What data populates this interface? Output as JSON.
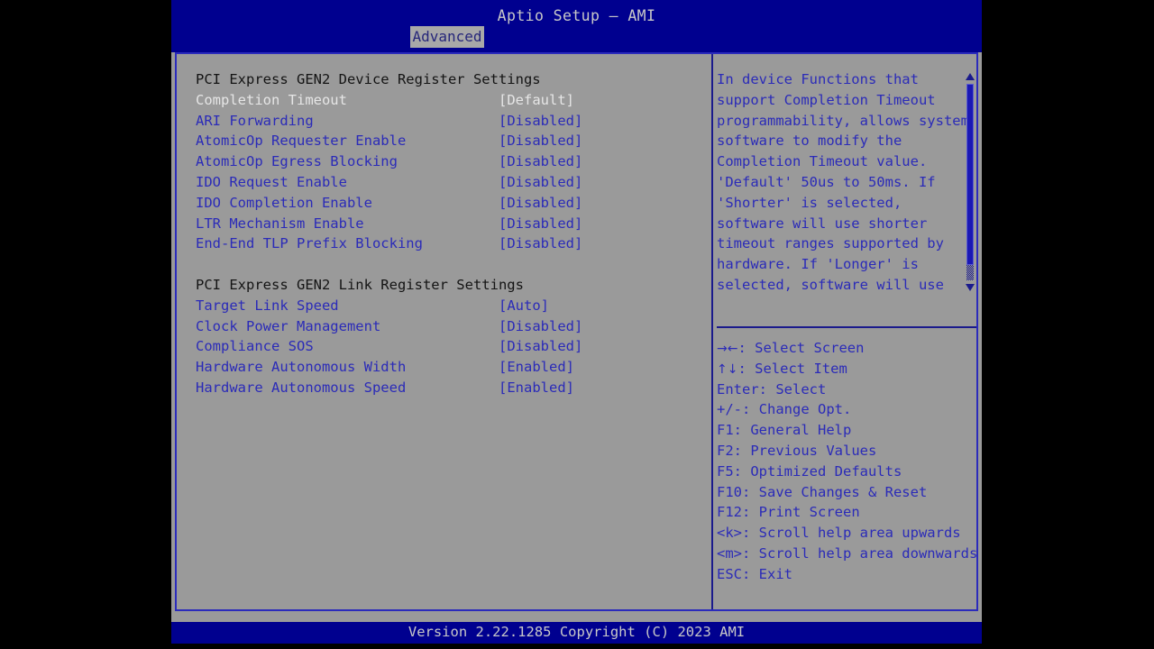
{
  "app": {
    "title": "Aptio Setup – AMI",
    "footer": "Version 2.22.1285 Copyright (C) 2023 AMI"
  },
  "tabs": [
    {
      "label": "Advanced",
      "active": true
    }
  ],
  "settings": {
    "groups": [
      {
        "header": "PCI Express GEN2 Device Register Settings",
        "items": [
          {
            "label": "Completion Timeout",
            "value": "[Default]",
            "selected": true
          },
          {
            "label": "ARI Forwarding",
            "value": "[Disabled]",
            "selected": false
          },
          {
            "label": "AtomicOp Requester Enable",
            "value": "[Disabled]",
            "selected": false
          },
          {
            "label": "AtomicOp Egress Blocking",
            "value": "[Disabled]",
            "selected": false
          },
          {
            "label": "IDO Request Enable",
            "value": "[Disabled]",
            "selected": false
          },
          {
            "label": "IDO Completion Enable",
            "value": "[Disabled]",
            "selected": false
          },
          {
            "label": "LTR Mechanism Enable",
            "value": "[Disabled]",
            "selected": false
          },
          {
            "label": "End-End TLP Prefix Blocking",
            "value": "[Disabled]",
            "selected": false
          }
        ]
      },
      {
        "header": "PCI Express GEN2 Link Register Settings",
        "items": [
          {
            "label": "Target Link Speed",
            "value": "[Auto]",
            "selected": false
          },
          {
            "label": "Clock Power Management",
            "value": "[Disabled]",
            "selected": false
          },
          {
            "label": "Compliance SOS",
            "value": "[Disabled]",
            "selected": false
          },
          {
            "label": "Hardware Autonomous Width",
            "value": "[Enabled]",
            "selected": false
          },
          {
            "label": "Hardware Autonomous Speed",
            "value": "[Enabled]",
            "selected": false
          }
        ]
      }
    ]
  },
  "help": {
    "lines": [
      "In device Functions that",
      "support Completion Timeout",
      "programmability, allows system",
      "software to modify the",
      "Completion Timeout value.",
      "'Default' 50us to 50ms. If",
      "'Shorter' is selected,",
      "software will use shorter",
      "timeout ranges supported by",
      "hardware. If 'Longer' is",
      "selected, software will use"
    ],
    "scrollbar": {
      "up_icon": "triangle-up-icon",
      "down_icon": "triangle-down-icon"
    }
  },
  "keys": [
    {
      "key": "→←",
      "label": ": Select Screen"
    },
    {
      "key": "↑↓",
      "label": ": Select Item"
    },
    {
      "key": "Enter",
      "label": ": Select"
    },
    {
      "key": "+/-",
      "label": ": Change Opt."
    },
    {
      "key": "F1",
      "label": ": General Help"
    },
    {
      "key": "F2",
      "label": ": Previous Values"
    },
    {
      "key": "F5",
      "label": ": Optimized Defaults"
    },
    {
      "key": "F10",
      "label": ": Save Changes & Reset"
    },
    {
      "key": "F12",
      "label": ": Print Screen"
    },
    {
      "key": "<k>",
      "label": ": Scroll help area upwards"
    },
    {
      "key": "<m>",
      "label": ": Scroll help area downwards"
    },
    {
      "key": "ESC",
      "label": ": Exit"
    }
  ],
  "colors": {
    "header_blue": "#00008f",
    "panel_gray": "#9a9a9a",
    "text_blue": "#2b2bb8",
    "text_selected": "#e6e6e6",
    "border_blue": "#2b2bbb"
  }
}
